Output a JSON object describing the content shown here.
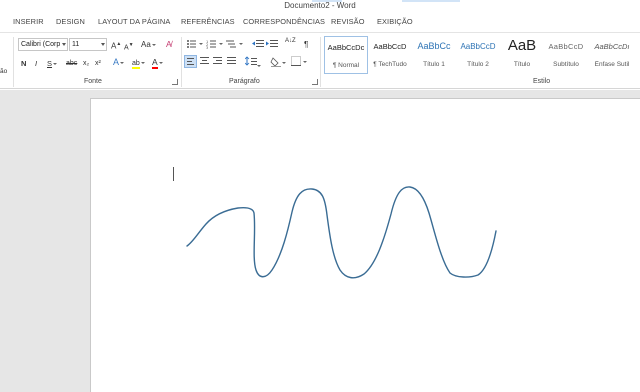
{
  "window": {
    "title": "Documento2 - Word"
  },
  "tabs": [
    "INSERIR",
    "DESIGN",
    "LAYOUT DA PÁGINA",
    "REFERÊNCIAS",
    "CORRESPONDÊNCIAS",
    "REVISÃO",
    "EXIBIÇÃO"
  ],
  "font": {
    "clipped_left_label": "ão",
    "name": "Calibri (Corp",
    "size": "11",
    "grow": "A",
    "shrink": "A",
    "case": "Aa",
    "bold": "N",
    "italic": "I",
    "underline": "S",
    "strike": "abc",
    "subscript": "x₂",
    "superscript": "x²",
    "effects": "A",
    "highlight": "ab",
    "color": "A",
    "group_label": "Fonte"
  },
  "paragraph": {
    "sort": "A↓Z",
    "pilcrow": "¶",
    "group_label": "Parágrafo"
  },
  "styles": {
    "items": [
      {
        "preview": "AaBbCcDc",
        "name": "¶ Normal"
      },
      {
        "preview": "AaBbCcD",
        "name": "¶ TechTudo"
      },
      {
        "preview": "AaBbCc",
        "name": "Título 1"
      },
      {
        "preview": "AaBbCcD",
        "name": "Título 2"
      },
      {
        "preview": "AaB",
        "name": "Título"
      },
      {
        "preview": "AaBbCcD",
        "name": "Subtítulo"
      },
      {
        "preview": "AaBbCcDı",
        "name": "Ênfase Sutil"
      }
    ],
    "group_label": "Estilo"
  },
  "colors": {
    "accent": "#2b579a",
    "ink": "#3a6c94",
    "highlight": "#ffff00",
    "font_color": "#ff0000"
  }
}
